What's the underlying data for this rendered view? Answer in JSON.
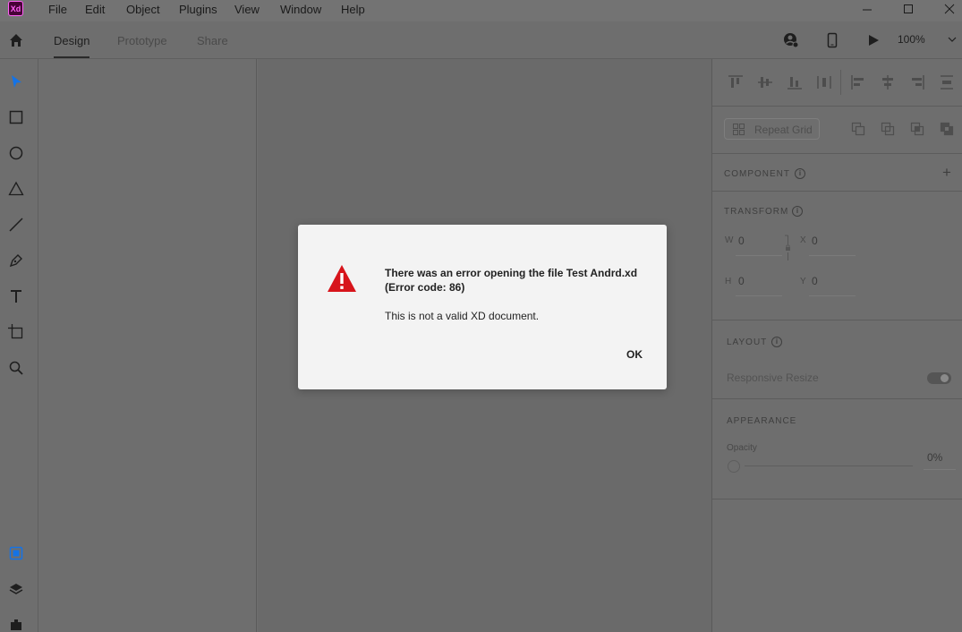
{
  "app": {
    "logo_text": "Xd"
  },
  "menu": [
    "File",
    "Edit",
    "Object",
    "Plugins",
    "View",
    "Window",
    "Help"
  ],
  "tabs": {
    "design": "Design",
    "prototype": "Prototype",
    "share": "Share"
  },
  "zoom": {
    "value": "100%"
  },
  "inspector": {
    "repeat_grid_label": "Repeat Grid",
    "component_title": "COMPONENT",
    "transform_title": "TRANSFORM",
    "transform": {
      "w_label": "W",
      "w_value": "0",
      "x_label": "X",
      "x_value": "0",
      "h_label": "H",
      "h_value": "0",
      "y_label": "Y",
      "y_value": "0"
    },
    "layout_title": "LAYOUT",
    "responsive_resize_label": "Responsive Resize",
    "appearance_title": "APPEARANCE",
    "opacity_label": "Opacity",
    "opacity_value": "0%",
    "add_symbol": "+"
  },
  "dialog": {
    "title": "There was an error opening the file Test Andrd.xd (Error code: 86)",
    "message": "This is not a valid XD document.",
    "ok_label": "OK"
  },
  "colors": {
    "accent": "#1473e6",
    "error_red": "#d7141b",
    "logo_bg": "#470137",
    "logo_fg": "#ff61f6"
  }
}
